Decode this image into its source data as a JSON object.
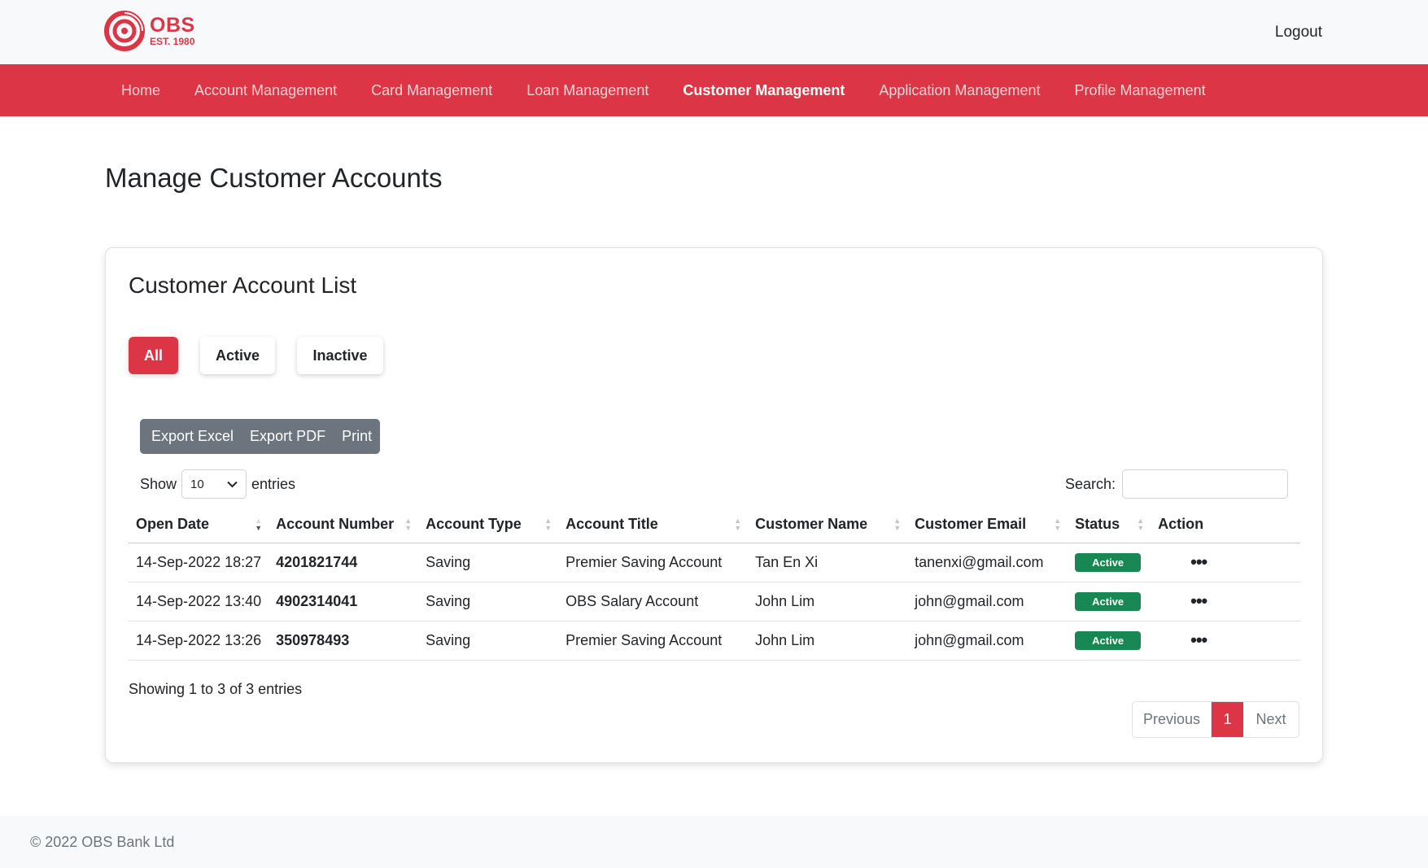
{
  "header": {
    "logo_name": "OBS",
    "logo_est": "EST. 1980",
    "logout_label": "Logout"
  },
  "nav": {
    "items": [
      {
        "label": "Home"
      },
      {
        "label": "Account Management"
      },
      {
        "label": "Card Management"
      },
      {
        "label": "Loan Management"
      },
      {
        "label": "Customer Management"
      },
      {
        "label": "Application Management"
      },
      {
        "label": "Profile Management"
      }
    ],
    "active_index": 4
  },
  "page": {
    "title": "Manage Customer Accounts"
  },
  "card": {
    "title": "Customer Account List",
    "filters": {
      "all": "All",
      "active": "Active",
      "inactive": "Inactive"
    },
    "export": {
      "excel": "Export Excel",
      "pdf": "Export PDF",
      "print": "Print"
    },
    "length": {
      "show_label": "Show",
      "value": "10",
      "entries_label": "entries"
    },
    "search": {
      "label": "Search:",
      "value": "",
      "placeholder": ""
    },
    "table": {
      "columns": [
        "Open Date",
        "Account Number",
        "Account Type",
        "Account Title",
        "Customer Name",
        "Customer Email",
        "Status",
        "Action"
      ],
      "rows": [
        {
          "open_date": "14-Sep-2022 18:27",
          "account_number": "4201821744",
          "account_type": "Saving",
          "account_title": "Premier Saving Account",
          "customer_name": "Tan En Xi",
          "customer_email": "tanenxi@gmail.com",
          "status": "Active",
          "action": "•••"
        },
        {
          "open_date": "14-Sep-2022 13:40",
          "account_number": "4902314041",
          "account_type": "Saving",
          "account_title": "OBS Salary Account",
          "customer_name": "John Lim",
          "customer_email": "john@gmail.com",
          "status": "Active",
          "action": "•••"
        },
        {
          "open_date": "14-Sep-2022 13:26",
          "account_number": "350978493",
          "account_type": "Saving",
          "account_title": "Premier Saving Account",
          "customer_name": "John Lim",
          "customer_email": "john@gmail.com",
          "status": "Active",
          "action": "•••"
        }
      ]
    },
    "info": "Showing 1 to 3 of 3 entries",
    "pagination": {
      "previous": "Previous",
      "current": "1",
      "next": "Next"
    }
  },
  "footer": {
    "text": "© 2022 OBS Bank Ltd"
  },
  "colors": {
    "brand_red": "#dc3545",
    "status_green": "#198754",
    "export_gray": "#6c757d"
  },
  "icons": {
    "logo": "obs-ring-logo-icon",
    "select_chevron": "chevron-down-icon",
    "sort": "sort-arrows-icon",
    "action": "more-dots-icon"
  }
}
